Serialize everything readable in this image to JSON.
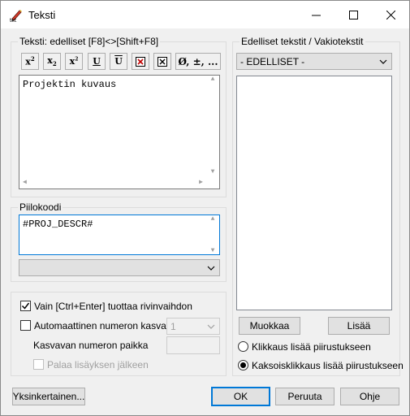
{
  "window": {
    "title": "Teksti"
  },
  "text_group": {
    "label": "Teksti:  edelliset [F8]<>[Shift+F8]",
    "toolbar": [
      {
        "name": "superscript-button",
        "label": "x²"
      },
      {
        "name": "subscript-button",
        "label": "x₂"
      },
      {
        "name": "super-sub-button",
        "label": "x²₂"
      },
      {
        "name": "underline-button",
        "label": "U"
      },
      {
        "name": "overline-button",
        "label": "Ū"
      },
      {
        "name": "boxed-x-button",
        "label": "✕"
      },
      {
        "name": "boxed-x-small-button",
        "label": "✕"
      },
      {
        "name": "special-chars-button",
        "label": "Ø, ±, ..."
      }
    ],
    "content": "Projektin kuvaus"
  },
  "hidden_code": {
    "label": "Piilokoodi",
    "content": "#PROJ_DESCR#",
    "combo_value": ""
  },
  "options": {
    "ctrl_enter_label": "Vain [Ctrl+Enter] tuottaa rivinvaihdon",
    "ctrl_enter_checked": true,
    "auto_number_label": "Automaattinen numeron kasvatus",
    "auto_number_checked": false,
    "auto_number_value": "1",
    "increment_position_label": "Kasvavan numeron paikka",
    "increment_position_value": "",
    "return_after_add_label": "Palaa lisäyksen jälkeen",
    "return_after_add_checked": false
  },
  "right_group": {
    "label": "Edelliset tekstit / Vakiotekstit",
    "combo_value": "- EDELLISET -",
    "edit_button": "Muokkaa",
    "add_button": "Lisää",
    "radio_click": "Klikkaus lisää piirustukseen",
    "radio_dblclick": "Kaksoisklikkaus lisää piirustukseen",
    "selected": "dblclick"
  },
  "footer": {
    "simple_button": "Yksinkertainen...",
    "ok_button": "OK",
    "cancel_button": "Peruuta",
    "help_button": "Ohje"
  }
}
